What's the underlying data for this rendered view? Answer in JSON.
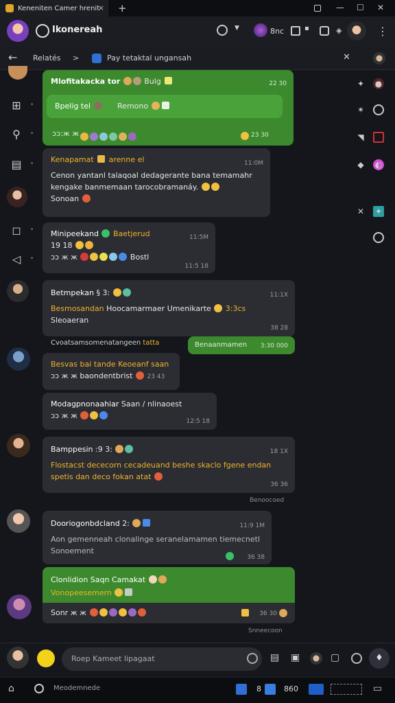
{
  "tab": {
    "title": "Keneniten Camer hrenit",
    "close": "×",
    "new": "+"
  },
  "window": {
    "min": "—",
    "max": "☐",
    "close": "✕"
  },
  "header": {
    "title": "Ikonereah",
    "badge": "8nc",
    "more": "⋮"
  },
  "breadcrumb": {
    "back": "←",
    "section": "Relatés",
    "sep": ">",
    "title": "Pay tetaktal ungansah",
    "close": "✕"
  },
  "messages": [
    {
      "name": "Mlofitakacka tor",
      "tag": "Bulg",
      "time": "22 30",
      "inner": "Bpelig tel",
      "inner2": "Remono",
      "line": "ɔɔ:ж ж",
      "time2": "23 30"
    },
    {
      "name": "Kenapamat",
      "tag": "arenne el",
      "time": "11:0M",
      "text1": "Cenon yantanl talaqoal dedagerante bana temamahr",
      "text2": "kengake banmemaan tarocobramanáy.",
      "text3": "Sonoan"
    },
    {
      "name": "Minipeekand",
      "tag": "Baetjerud",
      "time": "11:5M",
      "line1": "19 18",
      "line2": "ɔɔ ж ж",
      "tail": "Bostl",
      "time2": "11:5 18"
    },
    {
      "name": "Betmpekan",
      "tag": "§ 3:",
      "time": "11:1X",
      "text1": "Besmosandan",
      "text2": "Hoocamarmaer Umenikarte",
      "text3": "3:3cs",
      "text4": "Sleoaeran",
      "time2": "38 28"
    },
    {
      "name": "Cvoatsamsomenatangeen",
      "tag": "tatta",
      "green": "Benaanmamen",
      "time": "3:30 000"
    },
    {
      "name": "Besvas bai",
      "tag": "tande Keoeanf saan",
      "line": "ɔɔ ж ж baondentbrist",
      "time": "23 43"
    },
    {
      "name": "Modagpnonaahiar",
      "tag": "Saan / nlinaoest",
      "line": "ɔɔ ж ж",
      "time": "12:5 18"
    },
    {
      "name": "Bamppesin",
      "tag": ":9 3:",
      "time": "18 1X",
      "text1": "Flostacst dececorn cecadeuand beshe skaclo fgene endan",
      "text2": "spetis dan deco fokan atat",
      "time2": "36 36",
      "below": "Benoocoed"
    },
    {
      "name": "Dooriogonbdcland",
      "tag": "2:",
      "time": "11:9 1M",
      "text1": "Aon gemenneah clonalinge seranelamamen tiemecnetl",
      "text2": "Sonoement",
      "time2": "36 38"
    },
    {
      "name": "Clonlidion",
      "tag": "Saqn Camakat",
      "line1": "Vonopeesemern",
      "line2": "Sonr ж ж",
      "time": "36 30",
      "below": "Snneecoon"
    }
  ],
  "composer": {
    "placeholder": "Roep Kameet lipagaat"
  },
  "taskbar": {
    "search": "Meodemnede",
    "num": "8",
    "count": "860"
  },
  "colors": {
    "accent_green": "#3c8a2d",
    "name_yellow": "#f0b429",
    "bg": "#14161b",
    "bubble": "#2b2d33"
  }
}
